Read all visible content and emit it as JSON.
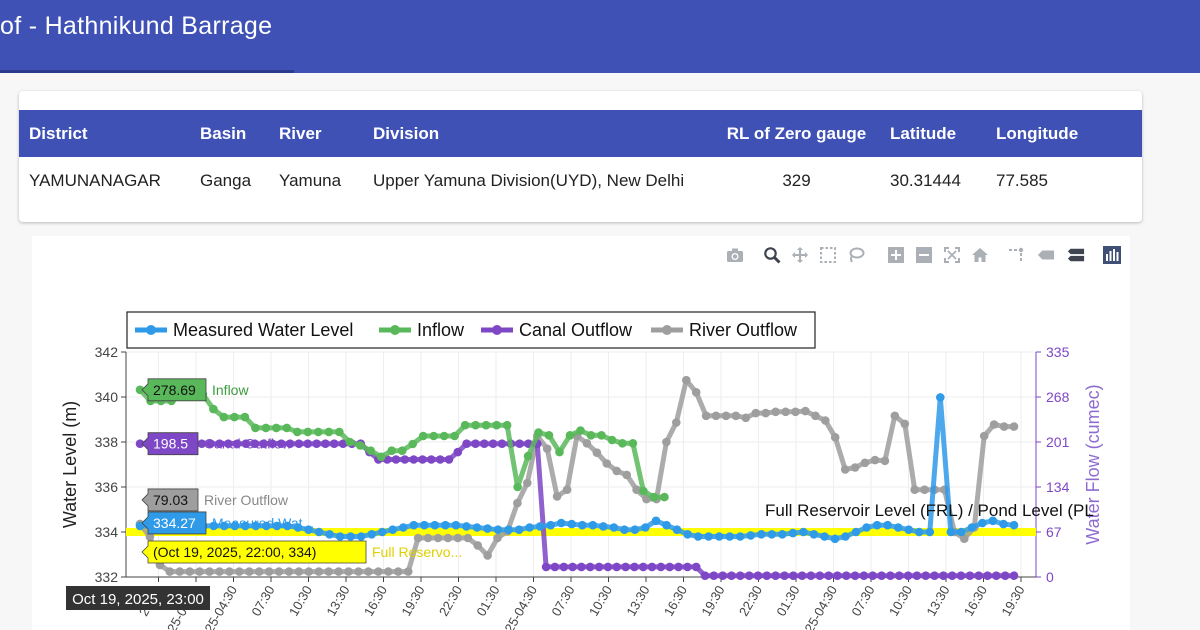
{
  "page": {
    "title": "of - Hathnikund Barrage"
  },
  "station_table": {
    "headers": [
      "District",
      "Basin",
      "River",
      "Division",
      "RL of Zero gauge",
      "Latitude",
      "Longitude"
    ],
    "row": [
      "YAMUNANAGAR",
      "Ganga",
      "Yamuna",
      "Upper Yamuna Division(UYD), New Delhi",
      "329",
      "30.31444",
      "77.585"
    ]
  },
  "modebar": {
    "icons": [
      "camera-icon",
      "zoom-icon",
      "pan-icon",
      "box-select-icon",
      "lasso-select-icon",
      "zoom-in-icon",
      "zoom-out-icon",
      "autoscale-icon",
      "reset-axes-icon",
      "spike-lines-icon",
      "hover-closest-icon",
      "hover-compare-icon",
      "plotly-logo-icon"
    ]
  },
  "chart_data": {
    "type": "line",
    "xlabel": "",
    "ylabel": "Water Level (m)",
    "y2label": "Water Flow (cumec)",
    "ylim": [
      332,
      342
    ],
    "y2lim": [
      0,
      335
    ],
    "yticks": [
      "332",
      "334",
      "336",
      "338",
      "340",
      "342"
    ],
    "y2ticks": [
      "0",
      "67",
      "134",
      "201",
      "268",
      "335"
    ],
    "xticks": [
      "22:30",
      "2025-01:30",
      "2025-04:30",
      "07:30",
      "10:30",
      "13:30",
      "16:30",
      "19:30",
      "22:30",
      "01:30",
      "2025-04:30",
      "07:30",
      "10:30",
      "13:30",
      "16:30",
      "19:30",
      "22:30",
      "01:30",
      "2025-04:30",
      "07:30",
      "10:30",
      "13:30",
      "16:30",
      "19:30"
    ],
    "legend": [
      "Measured Water Level",
      "Inflow",
      "Canal Outflow",
      "River Outflow"
    ],
    "legend_position": "top-left",
    "colors": {
      "measured": "#2e9ae8",
      "inflow": "#59b85a",
      "canal": "#7e47c6",
      "river": "#9e9e9e",
      "frl": "#ffff00"
    },
    "frl_label": "Full Reservoir Level (FRL) / Pond Level (PL",
    "frl_value": 334,
    "series": [
      {
        "name": "Measured Water Level",
        "axis": "y",
        "values": [
          334.27,
          334.27,
          334.27,
          334.27,
          334.27,
          334.27,
          334.27,
          334.27,
          334.27,
          334.27,
          334.27,
          334.27,
          334.27,
          334.27,
          334.27,
          334.2,
          334.1,
          334.0,
          333.9,
          333.8,
          333.8,
          333.8,
          333.9,
          334.0,
          334.1,
          334.2,
          334.3,
          334.3,
          334.3,
          334.3,
          334.3,
          334.25,
          334.2,
          334.15,
          334.1,
          334.1,
          334.1,
          334.2,
          334.25,
          334.3,
          334.4,
          334.35,
          334.3,
          334.3,
          334.25,
          334.2,
          334.1,
          334.1,
          334.2,
          334.5,
          334.3,
          334.1,
          333.9,
          333.8,
          333.8,
          333.8,
          333.8,
          333.8,
          333.85,
          333.9,
          333.9,
          333.9,
          333.95,
          334.0,
          333.9,
          333.8,
          333.7,
          333.8,
          334.0,
          334.2,
          334.3,
          334.3,
          334.2,
          334.1,
          334.0,
          334.0,
          339.98,
          334.0,
          334.0,
          334.2,
          334.4,
          334.5,
          334.35,
          334.3
        ]
      },
      {
        "name": "Inflow",
        "axis": "y2",
        "values": [
          278.69,
          262,
          262,
          262,
          278,
          278,
          272,
          250,
          238,
          238,
          238,
          222,
          222,
          222,
          222,
          216,
          216,
          216,
          216,
          216,
          201,
          196,
          188,
          179,
          188,
          188,
          198,
          210,
          210,
          210,
          210,
          226,
          226,
          226,
          226,
          226,
          134,
          180,
          215,
          211,
          186,
          211,
          218,
          211,
          211,
          204,
          199,
          199,
          128,
          119,
          119
        ]
      },
      {
        "name": "Canal Outflow",
        "axis": "y2",
        "values": [
          198.5,
          198.5,
          198.5,
          198.5,
          198.5,
          198.5,
          198.5,
          198.5,
          198.5,
          198.5,
          198.5,
          198.5,
          198.5,
          198.5,
          198.5,
          198.5,
          198.5,
          198.5,
          198.5,
          198.5,
          198.5,
          198.5,
          198.5,
          198.5,
          198.5,
          198.5,
          186,
          175,
          175,
          175,
          175,
          175,
          175,
          175,
          175,
          175,
          186,
          198.5,
          198.5,
          198.5,
          198.5,
          198.5,
          198.5,
          198.5,
          198.5,
          198.5,
          15,
          15,
          15,
          15,
          15,
          15,
          15,
          15,
          15,
          15,
          15,
          15,
          15,
          15,
          15,
          15,
          15,
          15,
          2,
          2,
          2,
          2,
          2,
          2,
          2,
          2,
          2,
          2,
          2,
          2,
          2,
          2,
          2,
          2,
          2,
          2,
          2,
          2,
          2,
          2,
          2,
          2,
          2,
          2,
          2,
          2,
          2,
          2,
          2,
          2,
          2,
          2,
          2,
          2
        ]
      },
      {
        "name": "River Outflow",
        "axis": "y2",
        "values": [
          79.03,
          60,
          18,
          8,
          8,
          8,
          8,
          8,
          8,
          8,
          8,
          8,
          8,
          8,
          8,
          8,
          8,
          8,
          8,
          8,
          8,
          8,
          8,
          8,
          8,
          8,
          8,
          8,
          58,
          58,
          58,
          58,
          58,
          58,
          47,
          32,
          58,
          68,
          110,
          140,
          210,
          191,
          120,
          130,
          210,
          199,
          185,
          169,
          158,
          152,
          130,
          116,
          116,
          201,
          230,
          293,
          275,
          240,
          240,
          240,
          240,
          237,
          244,
          244,
          246,
          246,
          246,
          247,
          240,
          233,
          208,
          160,
          163,
          170,
          174,
          173,
          240,
          228,
          130,
          130,
          130,
          130,
          67,
          57,
          74,
          210,
          227,
          224,
          224
        ]
      }
    ],
    "hover_labels": {
      "date": "Oct 19, 2025, 23:00",
      "inflow": {
        "value": "278.69",
        "name": "Inflow"
      },
      "canal": {
        "value": "198.5",
        "name": "Canal Outflow"
      },
      "river": {
        "value": "79.03",
        "name": "River Outflow"
      },
      "measured": {
        "value": "334.27",
        "name": "Measured Wat..."
      },
      "frl": {
        "value": "(Oct 19, 2025, 22:00, 334)",
        "name": "Full Reservo..."
      }
    }
  }
}
